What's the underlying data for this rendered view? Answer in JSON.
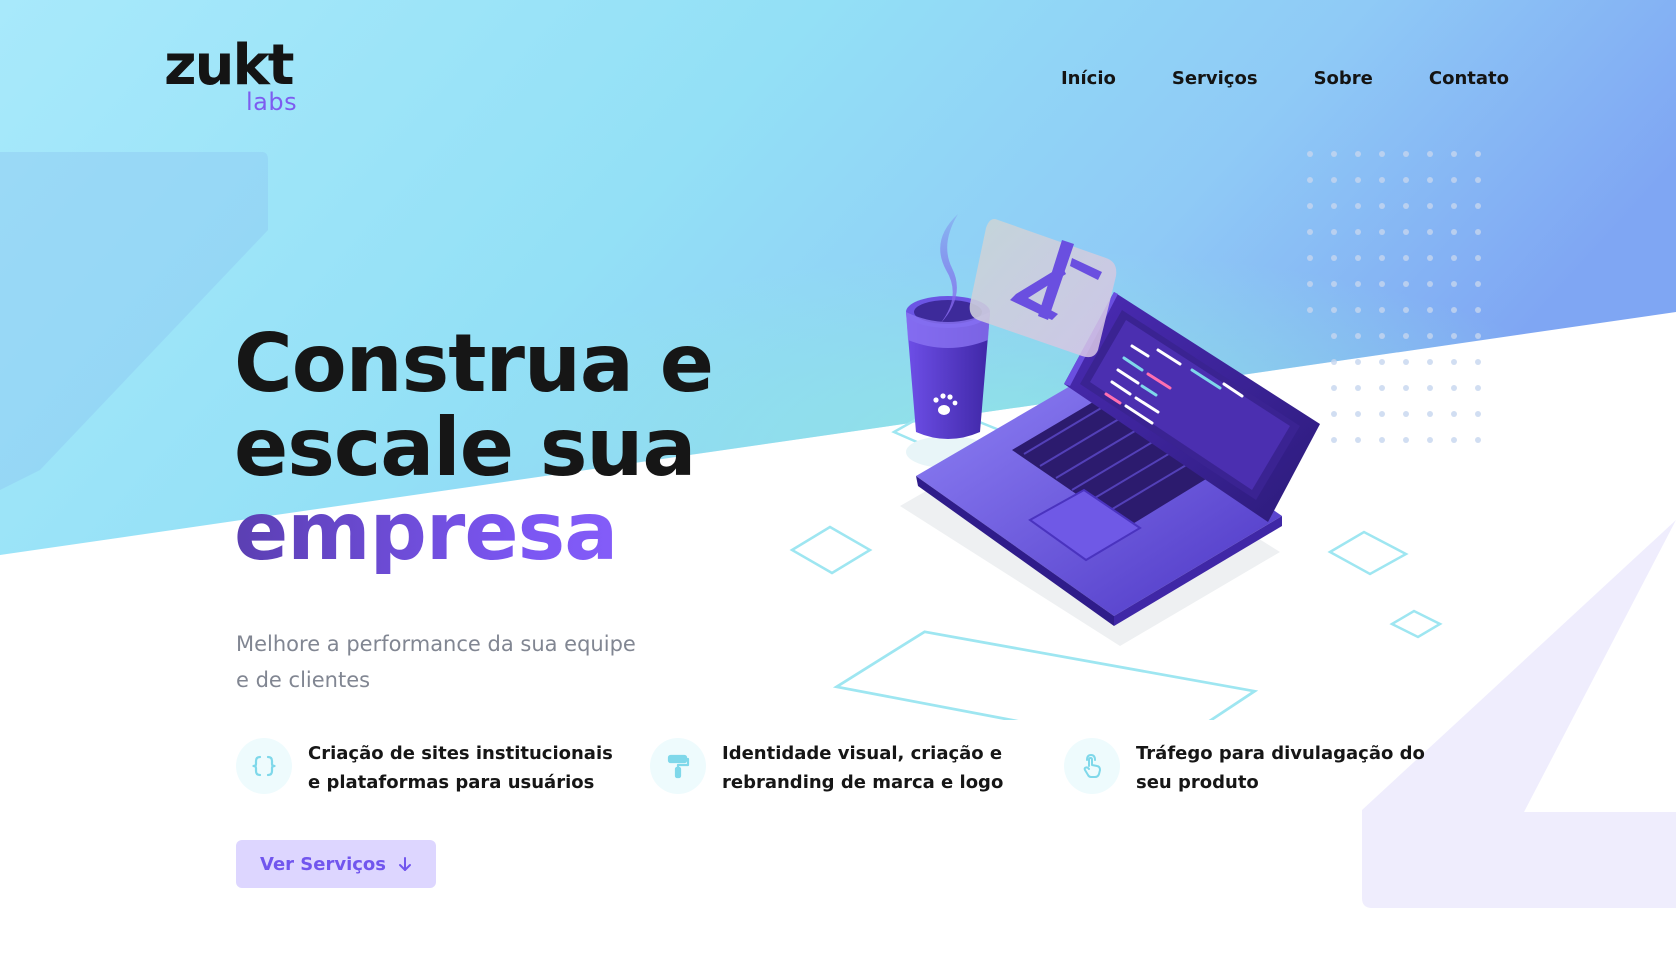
{
  "brand": {
    "wordmark": "zukt",
    "sub": "labs"
  },
  "nav": {
    "items": [
      "Início",
      "Serviços",
      "Sobre",
      "Contato"
    ]
  },
  "hero": {
    "headline_line1": "Construa e",
    "headline_line2": "escale sua",
    "headline_accent": "empresa",
    "subtitle": "Melhore a performance da sua equipe e de clientes"
  },
  "features": [
    {
      "icon": "curly-braces-icon",
      "text": "Criação de sites institucionais e plataformas para usuários"
    },
    {
      "icon": "paint-roller-icon",
      "text": "Identidade visual, criação e rebranding de marca e logo"
    },
    {
      "icon": "touch-hand-icon",
      "text": "Tráfego para divulagação do seu produto"
    }
  ],
  "cta": {
    "label": "Ver Serviços",
    "icon": "arrow-down-icon"
  },
  "colors": {
    "accent": "#7b56f2",
    "cta_bg": "#ddd6ff",
    "sky_start": "#a9e8f7",
    "sky_end": "#7fa9f4",
    "icon_teal": "#7fd8ea"
  }
}
